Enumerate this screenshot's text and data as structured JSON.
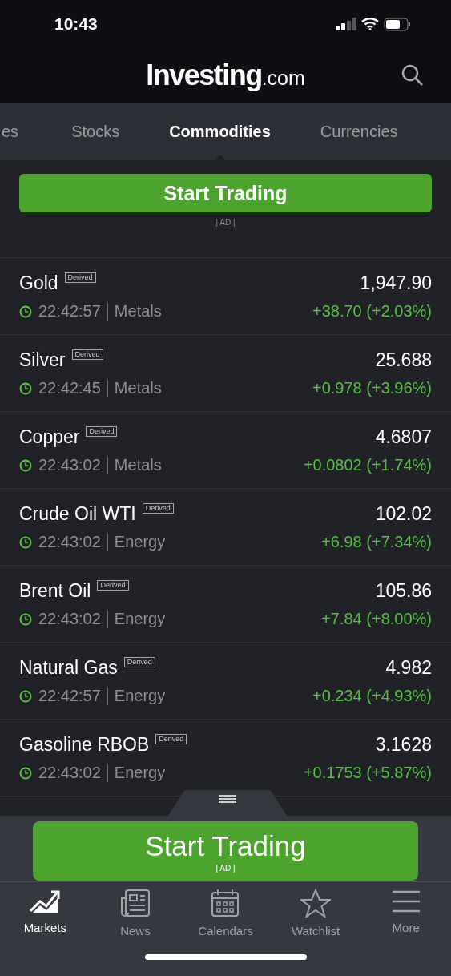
{
  "status_bar": {
    "time": "10:43"
  },
  "header": {
    "logo": "Investing",
    "logo_suffix": ".com"
  },
  "tabs": [
    {
      "label": "es",
      "selected": false
    },
    {
      "label": "Stocks",
      "selected": false
    },
    {
      "label": "Commodities",
      "selected": true
    },
    {
      "label": "Currencies",
      "selected": false
    }
  ],
  "top_ad": {
    "button": "Start Trading",
    "label": "| AD |"
  },
  "rows": [
    {
      "name": "Gold",
      "badge": "Derived",
      "price": "1,947.90",
      "time": "22:42:57",
      "group": "Metals",
      "change": "+38.70 (+2.03%)"
    },
    {
      "name": "Silver",
      "badge": "Derived",
      "price": "25.688",
      "time": "22:42:45",
      "group": "Metals",
      "change": "+0.978 (+3.96%)"
    },
    {
      "name": "Copper",
      "badge": "Derived",
      "price": "4.6807",
      "time": "22:43:02",
      "group": "Metals",
      "change": "+0.0802 (+1.74%)"
    },
    {
      "name": "Crude Oil WTI",
      "badge": "Derived",
      "price": "102.02",
      "time": "22:43:02",
      "group": "Energy",
      "change": "+6.98 (+7.34%)"
    },
    {
      "name": "Brent Oil",
      "badge": "Derived",
      "price": "105.86",
      "time": "22:43:02",
      "group": "Energy",
      "change": "+7.84 (+8.00%)"
    },
    {
      "name": "Natural Gas",
      "badge": "Derived",
      "price": "4.982",
      "time": "22:42:57",
      "group": "Energy",
      "change": "+0.234 (+4.93%)"
    },
    {
      "name": "Gasoline RBOB",
      "badge": "Derived",
      "price": "3.1628",
      "time": "22:43:02",
      "group": "Energy",
      "change": "+0.1753 (+5.87%)"
    }
  ],
  "bottom_ad": {
    "button": "Start Trading",
    "label": "| AD |"
  },
  "tab_bar": [
    {
      "kind": "markets",
      "label": "Markets",
      "selected": true
    },
    {
      "kind": "news",
      "label": "News",
      "selected": false
    },
    {
      "kind": "calendars",
      "label": "Calendars",
      "selected": false
    },
    {
      "kind": "watchlist",
      "label": "Watchlist",
      "selected": false
    },
    {
      "kind": "more",
      "label": "More",
      "selected": false
    }
  ]
}
